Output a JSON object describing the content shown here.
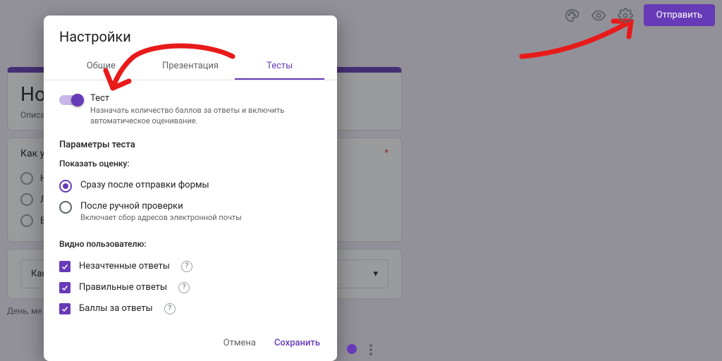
{
  "topbar": {
    "send_label": "Отправить"
  },
  "bg": {
    "form_title": "Нова",
    "form_desc": "Описание",
    "question": "Как узна",
    "options": [
      "Ника",
      "Легко",
      "Вари"
    ],
    "select_placeholder": "Как уз",
    "date_label": "День, ме"
  },
  "dialog": {
    "title": "Настройки",
    "tabs": {
      "general": "Общие",
      "presentation": "Презентация",
      "tests": "Тесты"
    },
    "quiz": {
      "label": "Тест",
      "sub": "Назначать количество баллов за ответы и включить автоматическое оценивание."
    },
    "params_title": "Параметры теста",
    "show_grade_title": "Показать оценку:",
    "grade_options": {
      "immediate": {
        "label": "Сразу после отправки формы"
      },
      "manual": {
        "label": "После ручной проверки",
        "sub": "Включает сбор адресов электронной почты"
      }
    },
    "visible_title": "Видно пользователю:",
    "checks": {
      "missed": "Незачтенные ответы",
      "correct": "Правильные ответы",
      "points": "Баллы за ответы"
    },
    "actions": {
      "cancel": "Отмена",
      "save": "Сохранить"
    }
  }
}
